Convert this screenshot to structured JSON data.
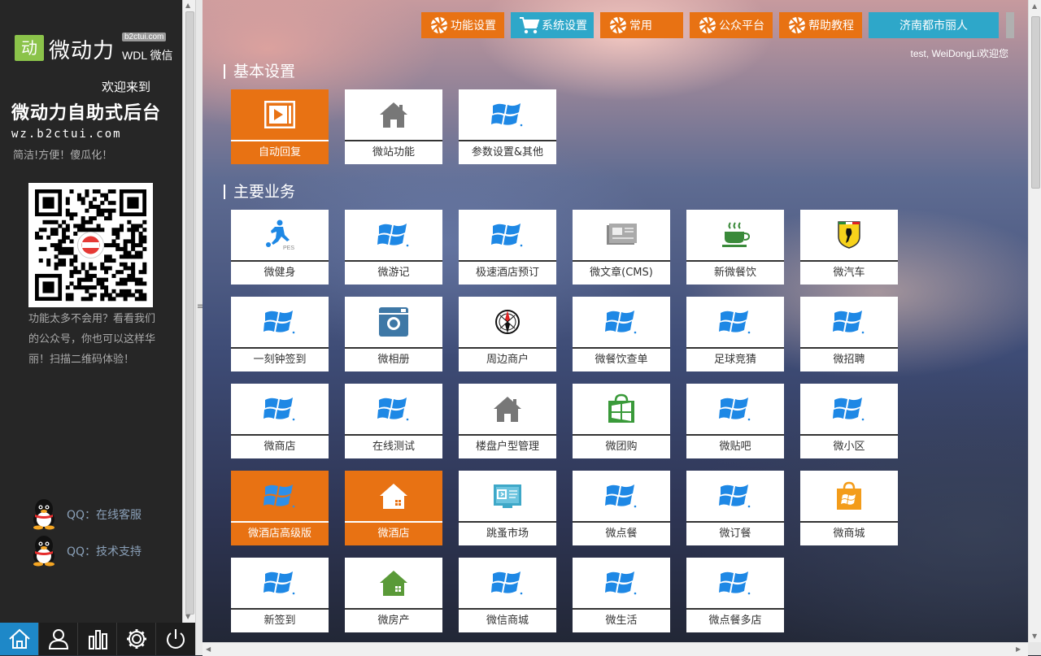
{
  "sidebar": {
    "logo_badge": "动",
    "logo_text": "微动力",
    "logo_domain": "b2ctui.com",
    "logo_sub": "WDL 微信",
    "welcome_line": "欢迎来到",
    "welcome_title": "微动力自助式后台",
    "welcome_url": "wz.b2ctui.com",
    "slogan": "简洁!方便！傻瓜化！",
    "qr_desc": "功能太多不会用？看看我们的公众号，你也可以这样华丽！扫描二维码体验！",
    "qq_links": [
      {
        "label": "QQ：在线客服"
      },
      {
        "label": "QQ：技术支持"
      }
    ]
  },
  "toolbar": {
    "buttons": [
      "home-icon",
      "user-icon",
      "stats-icon",
      "gear-icon",
      "power-icon"
    ]
  },
  "topnav": [
    {
      "label": "功能设置",
      "style": "orange",
      "icon": "aperture-icon"
    },
    {
      "label": "系统设置",
      "style": "blue",
      "icon": "cart-icon"
    },
    {
      "label": "常用",
      "style": "orange",
      "icon": "aperture-icon"
    },
    {
      "label": "公众平台",
      "style": "orange",
      "icon": "aperture-icon"
    },
    {
      "label": "帮助教程",
      "style": "orange",
      "icon": "aperture-icon"
    },
    {
      "label": "济南都市丽人",
      "style": "blue",
      "icon": ""
    }
  ],
  "greeting": "test, WeiDongLi欢迎您",
  "sections": [
    {
      "title": "基本设置",
      "tiles": [
        {
          "label": "自动回复",
          "icon": "play-icon",
          "style": "orange"
        },
        {
          "label": "微站功能",
          "icon": "house-icon",
          "style": "white"
        },
        {
          "label": "参数设置&其他",
          "icon": "windows-icon",
          "style": "white"
        }
      ]
    },
    {
      "title": "主要业务",
      "tiles": [
        {
          "label": "微健身",
          "icon": "soccer-player-icon",
          "style": "white"
        },
        {
          "label": "微游记",
          "icon": "windows-icon",
          "style": "white"
        },
        {
          "label": "极速酒店预订",
          "icon": "windows-icon",
          "style": "white"
        },
        {
          "label": "微文章(CMS)",
          "icon": "card-icon",
          "style": "white"
        },
        {
          "label": "新微餐饮",
          "icon": "coffee-icon",
          "style": "white"
        },
        {
          "label": "微汽车",
          "icon": "ferrari-shield-icon",
          "style": "white"
        },
        {
          "label": "一刻钟签到",
          "icon": "windows-icon",
          "style": "white"
        },
        {
          "label": "微相册",
          "icon": "camera-icon",
          "style": "white"
        },
        {
          "label": "周边商户",
          "icon": "compass-icon",
          "style": "white"
        },
        {
          "label": "微餐饮查单",
          "icon": "windows-icon",
          "style": "white"
        },
        {
          "label": "足球竞猜",
          "icon": "windows-icon",
          "style": "white"
        },
        {
          "label": "微招聘",
          "icon": "windows-icon",
          "style": "white"
        },
        {
          "label": "微商店",
          "icon": "windows-icon",
          "style": "white"
        },
        {
          "label": "在线测试",
          "icon": "windows-icon",
          "style": "white"
        },
        {
          "label": "楼盘户型管理",
          "icon": "house-icon",
          "style": "white"
        },
        {
          "label": "微团购",
          "icon": "store-bag-icon",
          "style": "white"
        },
        {
          "label": "微贴吧",
          "icon": "windows-icon",
          "style": "white"
        },
        {
          "label": "微小区",
          "icon": "windows-icon",
          "style": "white"
        },
        {
          "label": "微酒店高级版",
          "icon": "windows-icon",
          "style": "orange"
        },
        {
          "label": "微酒店",
          "icon": "house-white-icon",
          "style": "orange"
        },
        {
          "label": "跳蚤市场",
          "icon": "monitor-icon",
          "style": "white"
        },
        {
          "label": "微点餐",
          "icon": "windows-icon",
          "style": "white"
        },
        {
          "label": "微订餐",
          "icon": "windows-icon",
          "style": "white"
        },
        {
          "label": "微商城",
          "icon": "shopping-bag-icon",
          "style": "white"
        },
        {
          "label": "新签到",
          "icon": "windows-icon",
          "style": "white"
        },
        {
          "label": "微房产",
          "icon": "house-green-icon",
          "style": "white"
        },
        {
          "label": "微信商城",
          "icon": "windows-icon",
          "style": "white"
        },
        {
          "label": "微生活",
          "icon": "windows-icon",
          "style": "white"
        },
        {
          "label": "微点餐多店",
          "icon": "windows-icon",
          "style": "white"
        }
      ]
    }
  ],
  "colors": {
    "accent_orange": "#e87213",
    "accent_blue": "#2ea7c9",
    "sidebar_bg": "#262626",
    "toolbar_active": "#1e88c8",
    "windows_blue": "#1e88e5"
  }
}
